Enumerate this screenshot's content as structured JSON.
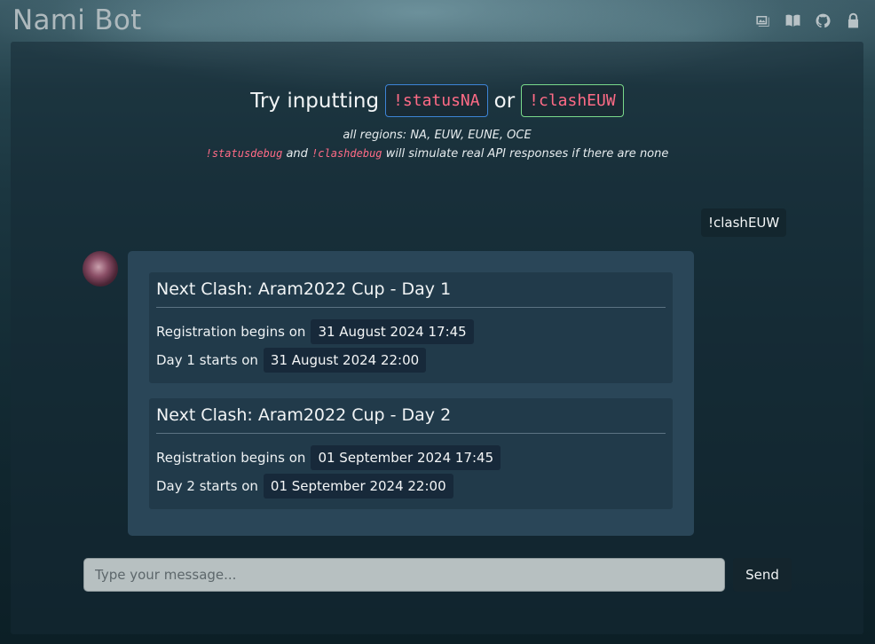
{
  "header": {
    "title": "Nami Bot",
    "icons": [
      "gallery-icon",
      "book-icon",
      "github-icon",
      "lock-icon"
    ]
  },
  "hint": {
    "prefix": "Try inputting",
    "cmd1": "!statusNA",
    "or": "or",
    "cmd2": "!clashEUW",
    "regions": "all regions: NA, EUW, EUNE, OCE",
    "debug_cmd1": "!statusdebug",
    "debug_and": "and",
    "debug_cmd2": "!clashdebug",
    "debug_suffix": "will simulate real API responses if there are none"
  },
  "chat": {
    "user_message": "!clashEUW",
    "clashes": [
      {
        "title": "Next Clash: Aram2022 Cup - Day 1",
        "registration_label": "Registration begins on",
        "registration_value": "31 August 2024 17:45",
        "start_label": "Day 1 starts on",
        "start_value": "31 August 2024 22:00"
      },
      {
        "title": "Next Clash: Aram2022 Cup - Day 2",
        "registration_label": "Registration begins on",
        "registration_value": "01 September 2024 17:45",
        "start_label": "Day 2 starts on",
        "start_value": "01 September 2024 22:00"
      }
    ]
  },
  "composer": {
    "placeholder": "Type your message...",
    "send_label": "Send"
  },
  "colors": {
    "code": "#ff6b86",
    "chip_blue_border": "#3d84d6",
    "chip_green_border": "#79d98b",
    "bot_bubble": "#2a4658"
  }
}
